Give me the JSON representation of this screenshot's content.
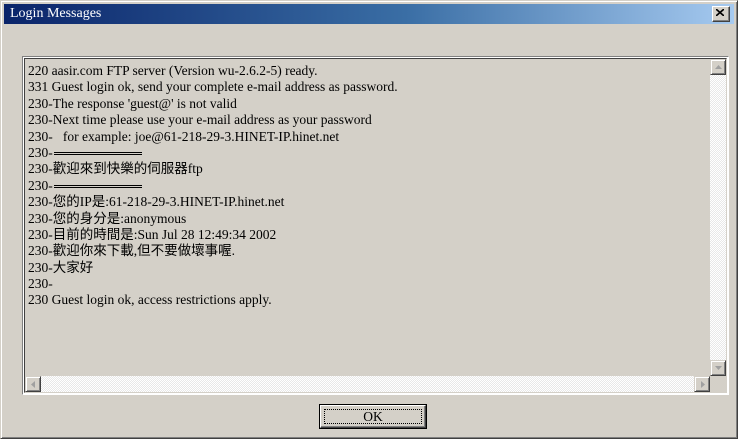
{
  "window": {
    "title": "Login Messages",
    "close_icon": "close-icon"
  },
  "messages": [
    "220 aasir.com FTP server (Version wu-2.6.2-5) ready.",
    "331 Guest login ok, send your complete e-mail address as password.",
    "230-The response 'guest@' is not valid",
    "230-Next time please use your e-mail address as your password",
    "230-   for example: joe@61-218-29-3.HINET-IP.hinet.net",
    "230-",
    "230-歡迎來到快樂的伺服器ftp",
    "230-",
    "230-您的IP是:61-218-29-3.HINET-IP.hinet.net",
    "230-您的身分是:anonymous",
    "230-目前的時間是:Sun Jul 28 12:49:34 2002",
    "230-歡迎你來下載,但不要做壞事喔.",
    "230-大家好",
    "230-",
    "230 Guest login ok, access restrictions apply."
  ],
  "buttons": {
    "ok_label": "OK"
  },
  "scrollbars": {
    "up_icon": "arrow-up-icon",
    "down_icon": "arrow-down-icon",
    "left_icon": "arrow-left-icon",
    "right_icon": "arrow-right-icon"
  }
}
